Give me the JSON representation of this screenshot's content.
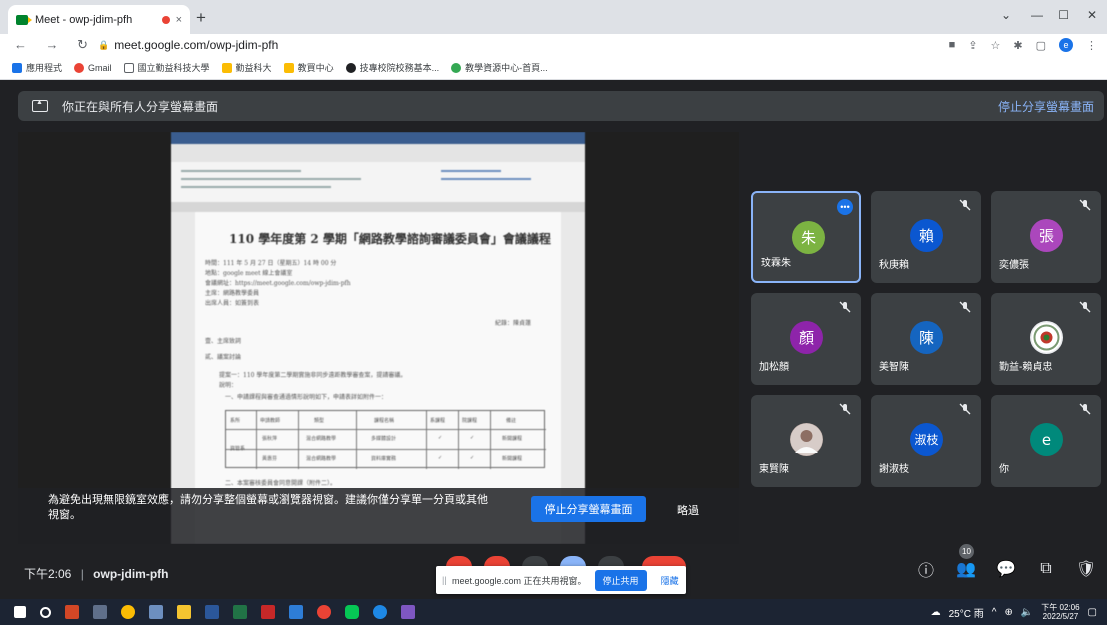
{
  "browser": {
    "tab_title": "Meet - owp-jdim-pfh",
    "tab_close": "×",
    "new_tab": "+",
    "url": "meet.google.com/owp-jdim-pfh",
    "profile_initial": "e",
    "window_controls": [
      "⌄",
      "—",
      "☐",
      "✕"
    ]
  },
  "bookmarks": [
    {
      "label": "應用程式",
      "color": "#1a73e8"
    },
    {
      "label": "Gmail",
      "color": "#ea4335"
    },
    {
      "label": "國立勤益科技大學",
      "color": "#5f6368"
    },
    {
      "label": "勤益科大",
      "color": "#fbbc04"
    },
    {
      "label": "教買中心",
      "color": "#fbbc04"
    },
    {
      "label": "技專校院校務基本...",
      "color": "#202124"
    },
    {
      "label": "教學資源中心-首頁...",
      "color": "#34a853"
    }
  ],
  "banner": {
    "text": "你正在與所有人分享螢幕畫面",
    "stop_link": "停止分享螢幕畫面"
  },
  "document": {
    "title": "110 學年度第 2 學期「網路教學諮詢審議委員會」會議議程",
    "lines": [
      "時間：111 年 5 月 27 日（星期五）14 時 00 分",
      "地點：google meet 線上會議室",
      "會議網址：https://meet.google.com/owp-jdim-pfh",
      "主席：網路教學委員",
      "出席人員：如簽到表",
      "紀錄：陳貞蓮",
      "壹、主席致詞",
      "貳、議案討論",
      "提案一：110 學年度第二學期實施非同步遠距教學審查案，提請審議。",
      "說明：",
      "一、申請課程與審查通過情形說明如下，申請表詳如附件一："
    ],
    "table_headers": [
      "系所",
      "申請教師",
      "類型",
      "課程名稱",
      "系課程",
      "院課程",
      "備註"
    ],
    "table_rows": [
      [
        "資管系",
        "張秋萍",
        "混合網路教學",
        "多媒體設計",
        "✓",
        "✓",
        "新開課程"
      ],
      [
        "",
        "黃惠芬",
        "混合網路教學",
        "資料庫實務",
        "✓",
        "✓",
        "新開課程"
      ]
    ],
    "footer_line": "二、本案審核委員會同意開課（附件二）。"
  },
  "share_warning": {
    "text": "為避免出現無限鏡室效應，請勿分享整個螢幕或瀏覽器視窗。建議你僅分享單一分頁或其他視窗。",
    "stop_button": "停止分享螢幕畫面",
    "ignore_button": "略過"
  },
  "participants": [
    {
      "initial": "朱",
      "name": "玟霖朱",
      "color": "#7cb342",
      "active": true,
      "muted": false
    },
    {
      "initial": "賴",
      "name": "秋庚賴",
      "color": "#0b57d0",
      "active": false,
      "muted": true
    },
    {
      "initial": "張",
      "name": "奕儂張",
      "color": "#ab47bc",
      "active": false,
      "muted": true
    },
    {
      "initial": "顏",
      "name": "加松顏",
      "color": "#8e24aa",
      "active": false,
      "muted": true
    },
    {
      "initial": "陳",
      "name": "美智陳",
      "color": "#1565c0",
      "active": false,
      "muted": true
    },
    {
      "initial": "",
      "name": "勤益-賴貞忠",
      "color": "#e8eaed",
      "active": false,
      "muted": true
    },
    {
      "initial": "",
      "name": "東賢陳",
      "color": "#bcaaa4",
      "active": false,
      "muted": true
    },
    {
      "initial": "淑枝",
      "name": "謝淑枝",
      "color": "#0b57d0",
      "active": false,
      "muted": true
    },
    {
      "initial": "e",
      "name": "你",
      "color": "#00897b",
      "active": false,
      "muted": true
    }
  ],
  "controls": {
    "time": "下午2:06",
    "separator": "|",
    "meeting_code": "owp-jdim-pfh",
    "participant_count": "10"
  },
  "share_toast": {
    "handle": "||",
    "text": "meet.google.com 正在共用視窗。",
    "stop_button": "停止共用",
    "hide_button": "隱藏"
  },
  "taskbar": {
    "weather": "25°C 雨",
    "time": "下午 02:06",
    "date": "2022/5/27"
  }
}
